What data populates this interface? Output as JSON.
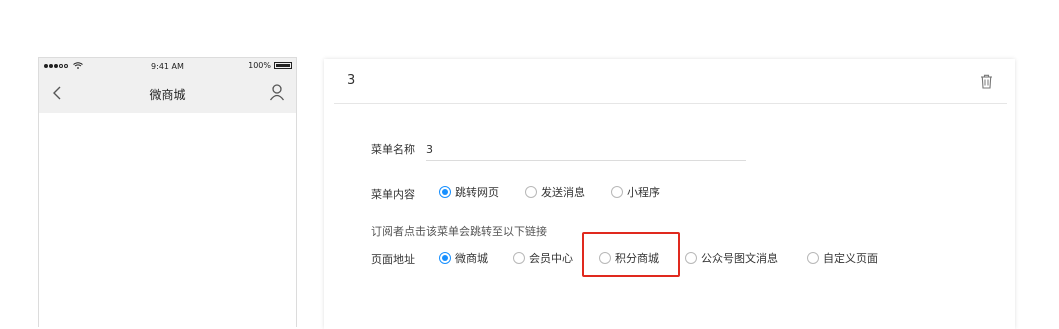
{
  "phone": {
    "status_time": "9:41 AM",
    "battery_text": "100%",
    "title": "微商城"
  },
  "card": {
    "menu_number": "3"
  },
  "form": {
    "name_label": "菜单名称",
    "name_value": "3",
    "content_label": "菜单内容",
    "content_options": [
      {
        "label": "跳转网页",
        "selected": true
      },
      {
        "label": "发送消息",
        "selected": false
      },
      {
        "label": "小程序",
        "selected": false
      }
    ],
    "hint": "订阅者点击该菜单会跳转至以下链接",
    "address_label": "页面地址",
    "address_options": [
      {
        "label": "微商城",
        "selected": true
      },
      {
        "label": "会员中心",
        "selected": false
      },
      {
        "label": "积分商城",
        "selected": false
      },
      {
        "label": "公众号图文消息",
        "selected": false
      },
      {
        "label": "自定义页面",
        "selected": false
      }
    ]
  },
  "colors": {
    "accent": "#1890ff",
    "highlight": "#e0291e"
  }
}
